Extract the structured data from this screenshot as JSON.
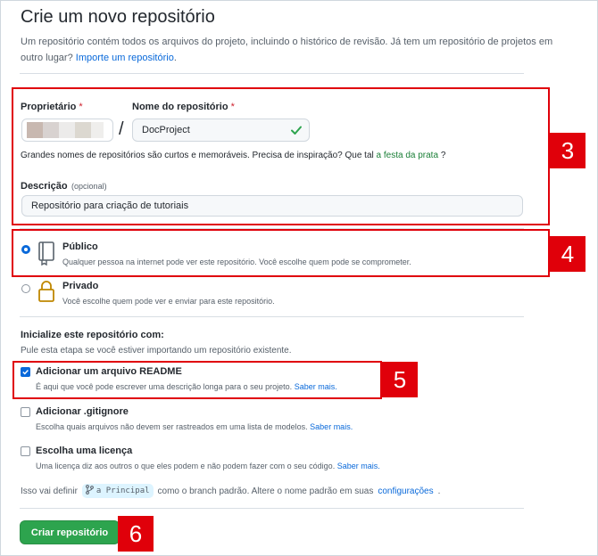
{
  "header": {
    "title": "Crie um novo repositório",
    "subtitle": "Um repositório contém todos os arquivos do projeto, incluindo o histórico de revisão. Já tem um repositório de projetos em outro lugar?",
    "import_link": "Importe um repositório",
    "import_suffix": "."
  },
  "form": {
    "owner_label": "Proprietário",
    "required_mark": "*",
    "name_label": "Nome do repositório",
    "separator": "/",
    "name_value": "DocProject",
    "hint_text": "Grandes nomes de repositórios são curtos e memoráveis. Precisa de inspiração? Que tal",
    "hint_link": "a festa da prata",
    "hint_suffix": "?",
    "description_label": "Descrição",
    "description_optional": "(opcional)",
    "description_value": "Repositório para criação de tutoriais"
  },
  "visibility": {
    "public_title": "Público",
    "public_desc": "Qualquer pessoa na internet pode ver este repositório. Você escolhe quem pode se comprometer.",
    "private_title": "Privado",
    "private_desc": "Você escolhe quem pode ver e enviar para este repositório.",
    "selected": "public"
  },
  "init": {
    "heading": "Inicialize este repositório com:",
    "sub": "Pule esta etapa se você estiver importando um repositório existente.",
    "readme_title": "Adicionar um arquivo README",
    "readme_desc": "É aqui que você pode escrever uma descrição longa para o seu projeto.",
    "gitignore_title": "Adicionar .gitignore",
    "gitignore_desc": "Escolha quais arquivos não devem ser rastreados em uma lista de modelos.",
    "license_title": "Escolha uma licença",
    "license_desc": "Uma licença diz aos outros o que eles podem e não podem fazer com o seu código.",
    "learn_more": "Saber mais.",
    "readme_checked": true,
    "gitignore_checked": false,
    "license_checked": false
  },
  "branch": {
    "prefix": "Isso vai definir",
    "name": "a Principal",
    "middle": "como o branch padrão. Altere o nome padrão em suas",
    "link": "configurações",
    "suffix": "."
  },
  "submit_label": "Criar repositório",
  "annotations": {
    "badge_3": "3",
    "badge_4": "4",
    "badge_5": "5",
    "badge_6": "6",
    "color": "#e0000a"
  },
  "colors": {
    "primary_button": "#2da44e",
    "link": "#0969da",
    "check": "#2da44e"
  }
}
